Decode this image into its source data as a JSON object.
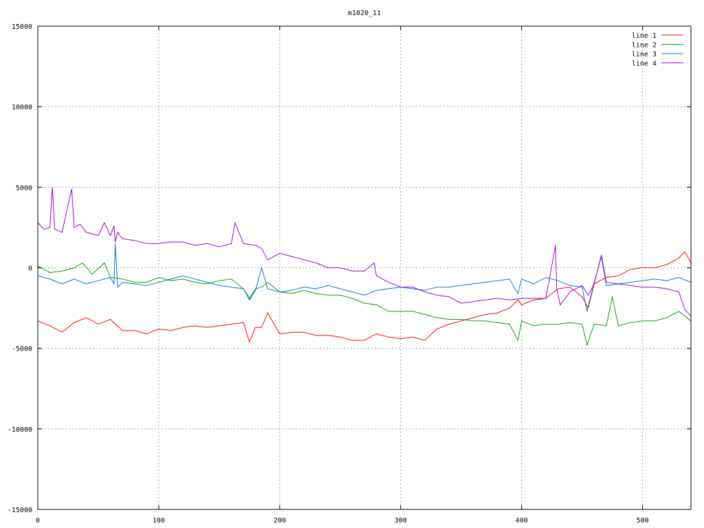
{
  "chart_data": {
    "type": "line",
    "title": "m1020_11",
    "xlabel": "",
    "ylabel": "",
    "xlim": [
      0,
      540
    ],
    "ylim": [
      -15000,
      15000
    ],
    "xticks": [
      0,
      100,
      200,
      300,
      400,
      500
    ],
    "yticks": [
      -15000,
      -10000,
      -5000,
      0,
      5000,
      10000,
      15000
    ],
    "grid": true,
    "legend_position": "top-right",
    "series": [
      {
        "name": "line 1",
        "color": "#ff0000",
        "x": [
          0,
          10,
          20,
          30,
          40,
          50,
          60,
          70,
          80,
          90,
          100,
          110,
          120,
          130,
          140,
          150,
          160,
          170,
          175,
          180,
          185,
          190,
          200,
          210,
          220,
          230,
          240,
          250,
          260,
          270,
          280,
          290,
          300,
          310,
          320,
          330,
          340,
          350,
          360,
          370,
          380,
          390,
          397,
          400,
          410,
          420,
          430,
          440,
          450,
          455,
          460,
          470,
          480,
          490,
          500,
          510,
          520,
          530,
          535,
          540
        ],
        "y": [
          -3300,
          -3600,
          -4000,
          -3400,
          -3100,
          -3500,
          -3200,
          -3900,
          -3900,
          -4100,
          -3800,
          -3900,
          -3700,
          -3600,
          -3700,
          -3600,
          -3500,
          -3400,
          -4600,
          -3700,
          -3700,
          -2800,
          -4100,
          -4000,
          -4000,
          -4200,
          -4200,
          -4300,
          -4500,
          -4500,
          -4100,
          -4300,
          -4400,
          -4300,
          -4500,
          -3800,
          -3500,
          -3300,
          -3100,
          -2900,
          -2800,
          -2500,
          -2000,
          -2300,
          -2000,
          -1900,
          -1300,
          -1200,
          -1800,
          -2500,
          -1000,
          -600,
          -500,
          -100,
          0,
          0,
          200,
          600,
          1000,
          300
        ]
      },
      {
        "name": "line 2",
        "color": "#00a000",
        "x": [
          0,
          10,
          20,
          30,
          37,
          45,
          55,
          60,
          70,
          80,
          90,
          100,
          110,
          120,
          130,
          140,
          150,
          160,
          170,
          175,
          180,
          185,
          190,
          200,
          210,
          220,
          230,
          240,
          250,
          260,
          270,
          280,
          290,
          300,
          310,
          320,
          330,
          340,
          350,
          360,
          370,
          380,
          390,
          397,
          400,
          410,
          420,
          430,
          440,
          450,
          454,
          460,
          470,
          475,
          480,
          490,
          500,
          510,
          520,
          530,
          540
        ],
        "y": [
          100,
          -300,
          -200,
          0,
          300,
          -400,
          300,
          -600,
          -700,
          -900,
          -900,
          -600,
          -800,
          -700,
          -900,
          -1000,
          -800,
          -700,
          -1300,
          -1900,
          -1300,
          -1200,
          -900,
          -1500,
          -1600,
          -1400,
          -1600,
          -1700,
          -1700,
          -1900,
          -2200,
          -2300,
          -2700,
          -2700,
          -2700,
          -2900,
          -3100,
          -3200,
          -3200,
          -3300,
          -3300,
          -3400,
          -3500,
          -4500,
          -3300,
          -3600,
          -3500,
          -3500,
          -3400,
          -3500,
          -4800,
          -3500,
          -3600,
          -1800,
          -3600,
          -3400,
          -3300,
          -3300,
          -3100,
          -2700,
          -3300
        ]
      },
      {
        "name": "line 3",
        "color": "#0078d0",
        "x": [
          0,
          10,
          20,
          30,
          40,
          50,
          60,
          63,
          64,
          66,
          70,
          80,
          90,
          100,
          110,
          120,
          130,
          140,
          150,
          160,
          170,
          175,
          180,
          185,
          190,
          200,
          210,
          220,
          230,
          240,
          250,
          260,
          270,
          280,
          290,
          300,
          310,
          320,
          330,
          340,
          350,
          360,
          370,
          380,
          390,
          397,
          400,
          410,
          420,
          430,
          440,
          450,
          454,
          460,
          466,
          470,
          480,
          490,
          500,
          510,
          520,
          530,
          540
        ],
        "y": [
          -500,
          -700,
          -1000,
          -700,
          -1000,
          -800,
          -600,
          -1000,
          1500,
          -1200,
          -900,
          -1000,
          -1100,
          -900,
          -700,
          -500,
          -700,
          -900,
          -1100,
          -1200,
          -1300,
          -2000,
          -1400,
          0,
          -1300,
          -1500,
          -1400,
          -1200,
          -1300,
          -1100,
          -1300,
          -1500,
          -1700,
          -1400,
          -1300,
          -1200,
          -1300,
          -1400,
          -1200,
          -1200,
          -1100,
          -1000,
          -900,
          -800,
          -700,
          -1600,
          -700,
          -1000,
          -600,
          -800,
          -1100,
          -1200,
          -2700,
          -900,
          700,
          -1100,
          -1000,
          -900,
          -800,
          -700,
          -800,
          -600,
          -900
        ]
      },
      {
        "name": "line 4",
        "color": "#a000d8",
        "x": [
          0,
          5,
          10,
          12,
          14,
          20,
          28,
          30,
          35,
          40,
          50,
          55,
          60,
          63,
          64,
          66,
          70,
          80,
          90,
          100,
          110,
          120,
          130,
          140,
          150,
          160,
          163,
          170,
          180,
          185,
          190,
          200,
          210,
          220,
          230,
          240,
          250,
          260,
          270,
          278,
          280,
          290,
          300,
          310,
          320,
          330,
          340,
          350,
          360,
          370,
          380,
          390,
          400,
          410,
          420,
          428,
          429,
          432,
          440,
          450,
          455,
          460,
          466,
          470,
          480,
          490,
          500,
          510,
          520,
          530,
          535,
          540
        ],
        "y": [
          2800,
          2400,
          2500,
          5000,
          2400,
          2200,
          4900,
          2500,
          2700,
          2200,
          2000,
          2800,
          2000,
          2600,
          1600,
          2200,
          1800,
          1700,
          1500,
          1500,
          1600,
          1600,
          1400,
          1500,
          1300,
          1500,
          2800,
          1500,
          1400,
          1200,
          500,
          900,
          700,
          500,
          300,
          0,
          0,
          -200,
          -200,
          300,
          -500,
          -900,
          -1200,
          -1200,
          -1500,
          -1700,
          -1800,
          -2200,
          -2100,
          -2000,
          -1900,
          -2000,
          -1900,
          -1900,
          -1900,
          1400,
          -1300,
          -2300,
          -1500,
          -1100,
          -1700,
          -1000,
          800,
          -900,
          -1000,
          -1100,
          -1200,
          -1200,
          -1300,
          -1500,
          -2600,
          -3000
        ]
      }
    ]
  }
}
